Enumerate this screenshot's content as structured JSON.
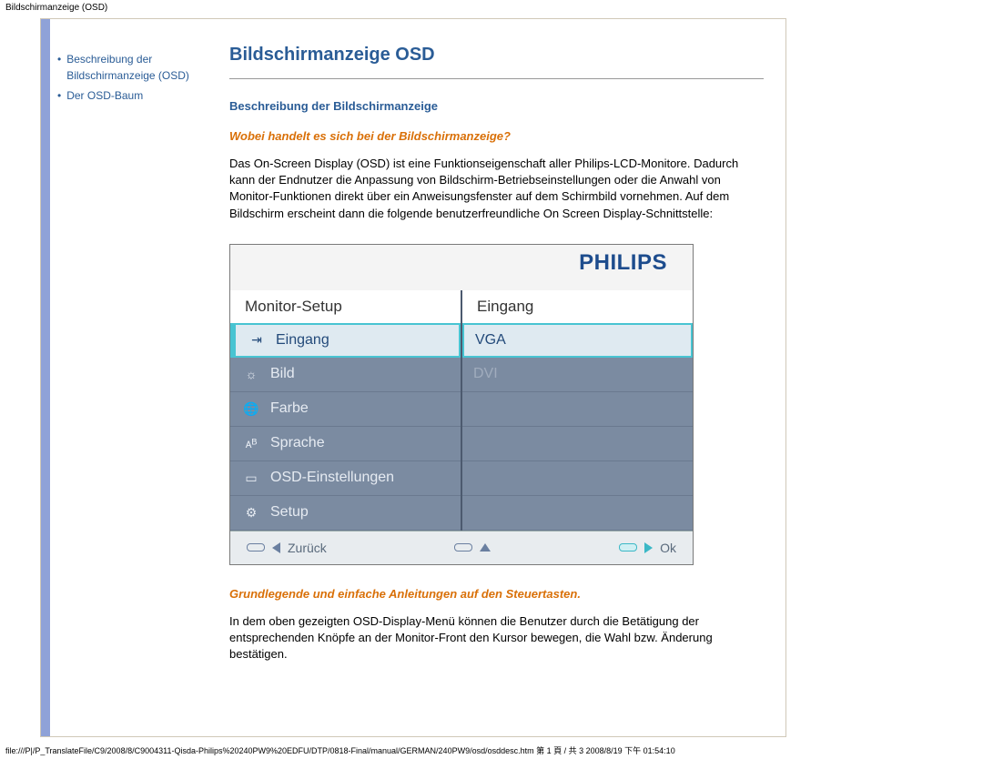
{
  "browser": {
    "title": "Bildschirmanzeige (OSD)"
  },
  "sidebar": {
    "items": [
      {
        "label": "Beschreibung der Bildschirmanzeige (OSD)"
      },
      {
        "label": "Der OSD-Baum"
      }
    ]
  },
  "content": {
    "title": "Bildschirmanzeige OSD",
    "section_heading": "Beschreibung der Bildschirmanzeige",
    "question1": "Wobei handelt es sich bei der Bildschirmanzeige?",
    "para1": "Das On-Screen Display (OSD) ist eine Funktionseigenschaft aller Philips-LCD-Monitore. Dadurch kann der Endnutzer die Anpassung von Bildschirm-Betriebseinstellungen oder die Anwahl von Monitor-Funktionen direkt über ein Anweisungsfenster auf dem Schirmbild vornehmen. Auf dem Bildschirm erscheint dann die folgende benutzerfreundliche On Screen Display-Schnittstelle:",
    "caption2": "Grundlegende und einfache Anleitungen auf den Steuertasten.",
    "para2": "In dem oben gezeigten OSD-Display-Menü können die Benutzer durch die Betätigung der entsprechenden Knöpfe an der Monitor-Front den Kursor bewegen, die Wahl bzw. Änderung bestätigen."
  },
  "osd": {
    "logo": "PHILIPS",
    "headers": {
      "left": "Monitor-Setup",
      "right": "Eingang"
    },
    "left_items": [
      {
        "icon": "input-icon",
        "label": "Eingang",
        "selected": true
      },
      {
        "icon": "brightness-icon",
        "label": "Bild"
      },
      {
        "icon": "globe-icon",
        "label": "Farbe"
      },
      {
        "icon": "language-icon",
        "label": "Sprache"
      },
      {
        "icon": "osd-settings-icon",
        "label": "OSD-Einstellungen"
      },
      {
        "icon": "gear-icon",
        "label": "Setup"
      }
    ],
    "right_items": [
      {
        "label": "VGA",
        "selected": true
      },
      {
        "label": "DVI",
        "muted": true
      }
    ],
    "footer": {
      "back": "Zurück",
      "ok": "Ok"
    }
  },
  "footer_path": "file:///P|/P_TranslateFile/C9/2008/8/C9004311-Qisda-Philips%20240PW9%20EDFU/DTP/0818-Final/manual/GERMAN/240PW9/osd/osddesc.htm 第 1 頁 / 共 3 2008/8/19 下午 01:54:10"
}
